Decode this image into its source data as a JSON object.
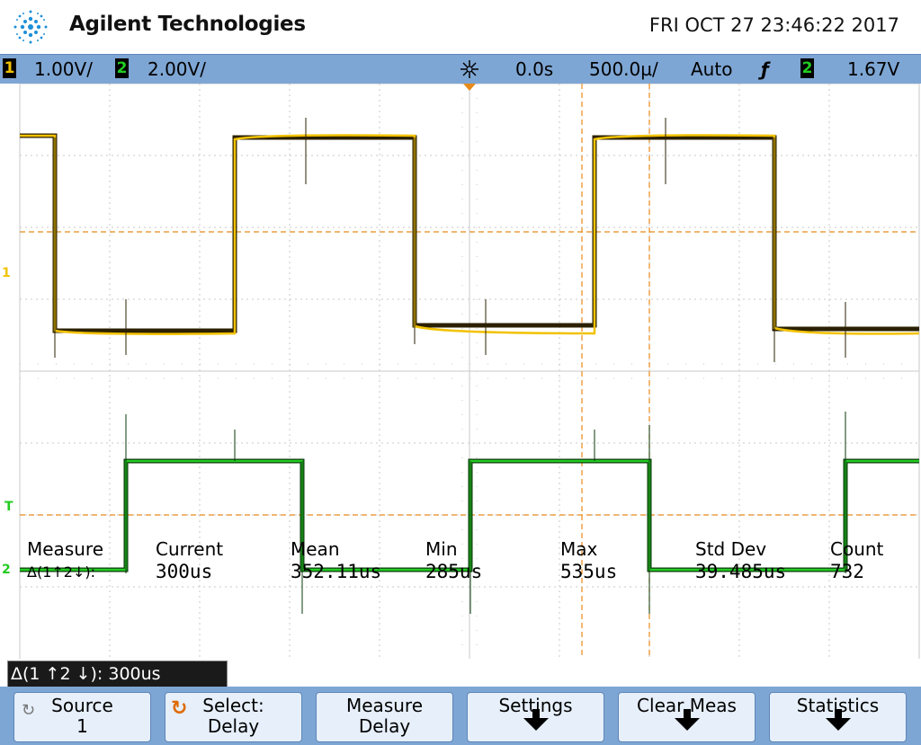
{
  "header": {
    "brand": "Agilent Technologies",
    "datetime": "FRI OCT 27 23:46:22 2017"
  },
  "status": {
    "ch1_num": "1",
    "ch1_scale": "1.00V/",
    "ch2_num": "2",
    "ch2_scale": "2.00V/",
    "delay": "0.0s",
    "timebase": "500.0µ/",
    "trigger_mode": "Auto",
    "trigger_slope_symbol": "ƒ",
    "trigger_source": "2",
    "trigger_level": "1.67V"
  },
  "markers": {
    "ch1_marker": "1",
    "ch2_marker": "2",
    "trigger_marker": "T"
  },
  "measurement": {
    "label": "Measure",
    "name": "Δ(1↑2↓):",
    "headers": [
      "Current",
      "Mean",
      "Min",
      "Max",
      "Std Dev",
      "Count"
    ],
    "values": [
      "300us",
      "352.11us",
      "285us",
      "535us",
      "39.485us",
      "732"
    ]
  },
  "delta_readout": "Δ(1 ↑2 ↓): 300us",
  "softkeys": [
    {
      "line1": "Source",
      "line2": "1"
    },
    {
      "line1": "Select:",
      "line2": "Delay"
    },
    {
      "line1": "Measure",
      "line2": "Delay"
    },
    {
      "line1": "Settings",
      "line2": ""
    },
    {
      "line1": "Clear Meas",
      "line2": ""
    },
    {
      "line1": "Statistics",
      "line2": ""
    }
  ],
  "colors": {
    "ch1": "#f2c200",
    "ch2": "#22cc22",
    "statusbar": "#7ea6d4",
    "cursor": "#e88a1a"
  }
}
